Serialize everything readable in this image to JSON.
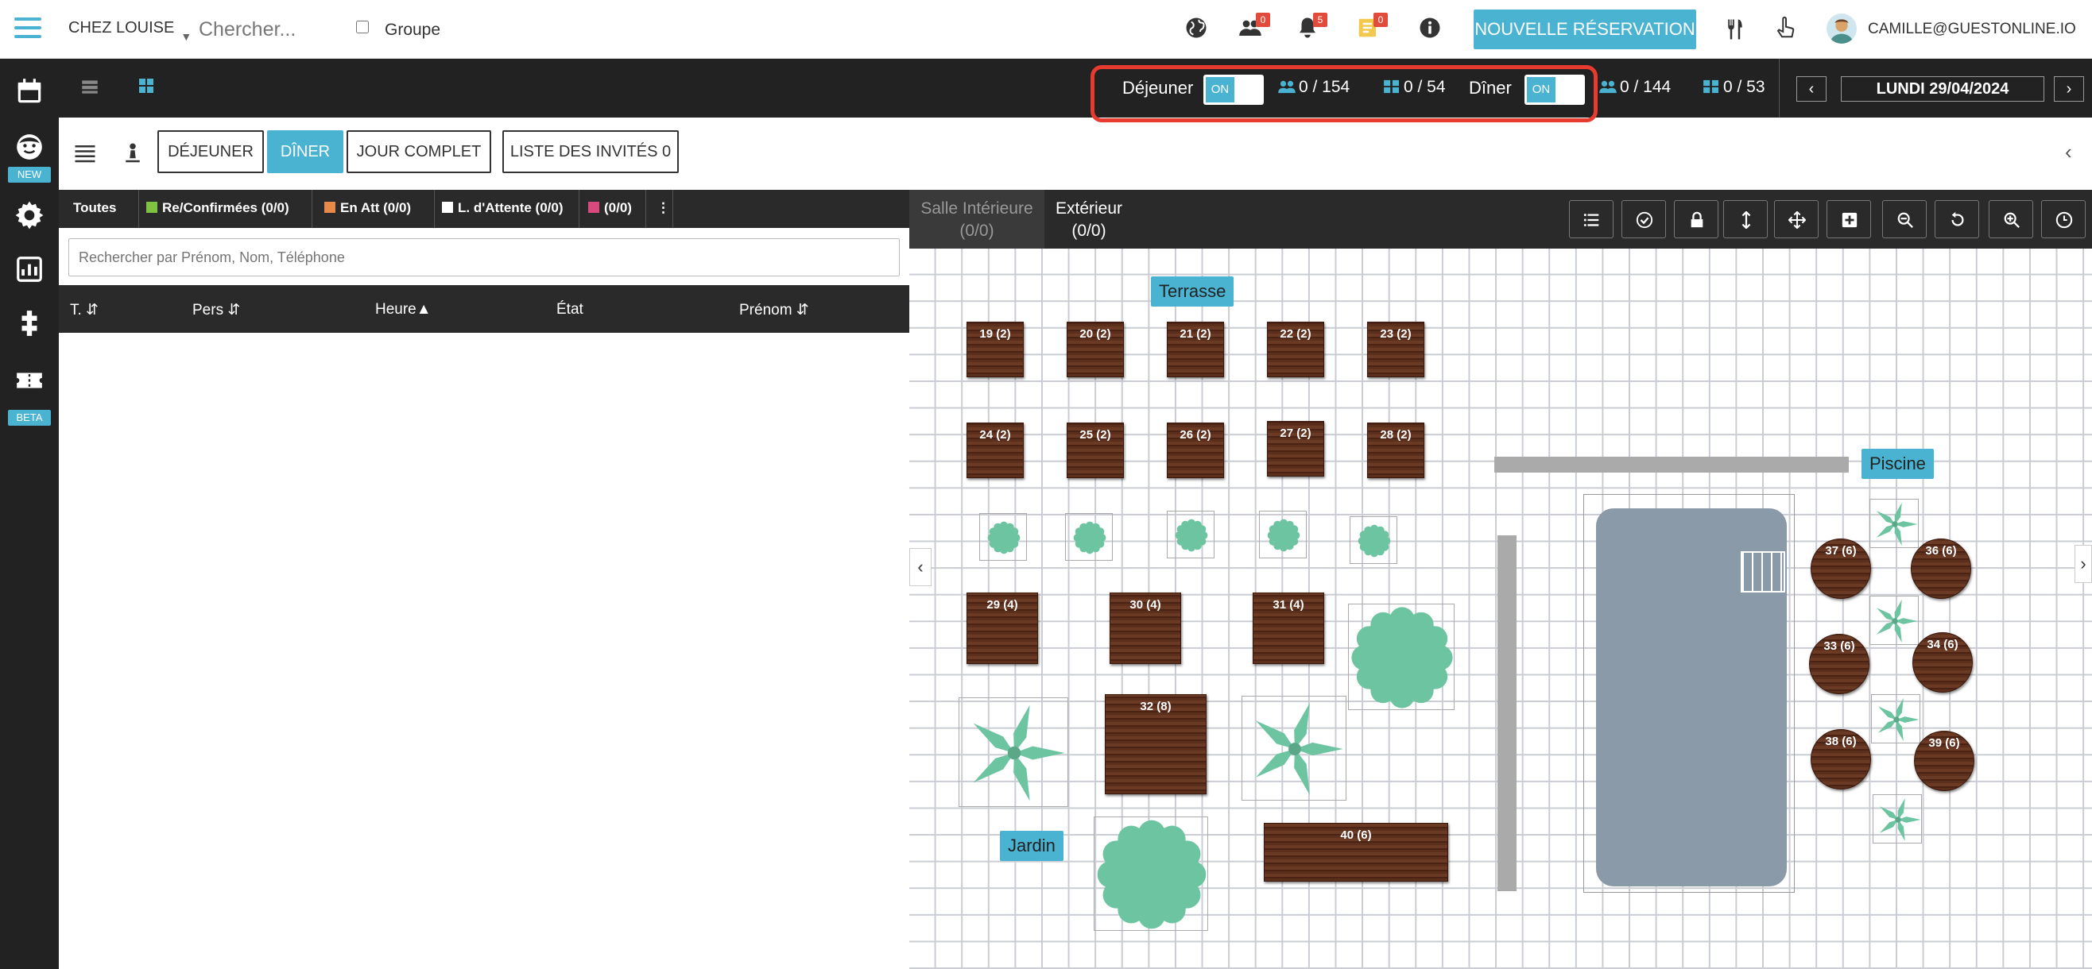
{
  "app": {
    "restaurant": "CHEZ LOUISE",
    "search_placeholder": "Chercher...",
    "group_label": "Groupe",
    "badges": {
      "people": "0",
      "bell": "5",
      "notes": "0"
    },
    "new_reservation": "NOUVELLE RÉSERVATION",
    "user": "CAMILLE@GUESTONLINE.IO"
  },
  "leftnav": {
    "new_badge": "NEW",
    "beta_badge": "BETA"
  },
  "services": {
    "lunch": {
      "label": "Déjeuner",
      "toggle": "ON",
      "covers": "0 / 154",
      "tables": "0 / 54"
    },
    "dinner": {
      "label": "Dîner",
      "toggle": "ON",
      "covers": "0 / 144",
      "tables": "0 / 53"
    },
    "date": "LUNDI 29/04/2024",
    "prev": "‹",
    "next": "›"
  },
  "tabs": {
    "lunch": "DÉJEUNER",
    "dinner": "DÎNER",
    "full_day": "JOUR COMPLET",
    "guest_list": "LISTE DES INVITÉS 0"
  },
  "filters": [
    {
      "label": "Toutes",
      "color": ""
    },
    {
      "label": "Re/Confirmées (0/0)",
      "color": "#7fc241"
    },
    {
      "label": "En Att (0/0)",
      "color": "#e8894a"
    },
    {
      "label": "L. d'Attente (0/0)",
      "color": "#ffffff"
    },
    {
      "label": "(0/0)",
      "color": "#d84a7e"
    }
  ],
  "list_search_placeholder": "Rechercher par Prénom, Nom, Téléphone",
  "columns": [
    "T. ⇵",
    "Pers ⇵",
    "Heure▲",
    "État",
    "Prénom ⇵"
  ],
  "rooms": [
    {
      "name": "Salle Intérieure",
      "count": "(0/0)"
    },
    {
      "name": "Extérieur",
      "count": "(0/0)"
    }
  ],
  "zones": {
    "terrasse": "Terrasse",
    "piscine": "Piscine",
    "jardin": "Jardin"
  },
  "tables": [
    "19 (2)",
    "20 (2)",
    "21 (2)",
    "22 (2)",
    "23 (2)",
    "24 (2)",
    "25 (2)",
    "26 (2)",
    "27 (2)",
    "28 (2)",
    "29 (4)",
    "30 (4)",
    "31 (4)",
    "32 (8)",
    "40 (6)",
    "37 (6)",
    "36 (6)",
    "33 (6)",
    "34 (6)",
    "38 (6)",
    "39 (6)"
  ],
  "colors": {
    "accent": "#4ab3d1",
    "dark": "#222222",
    "highlight": "#e63b2e",
    "wood": "#5c2e1c",
    "pool": "#8b9aa8",
    "plant": "#6cc4a0"
  }
}
